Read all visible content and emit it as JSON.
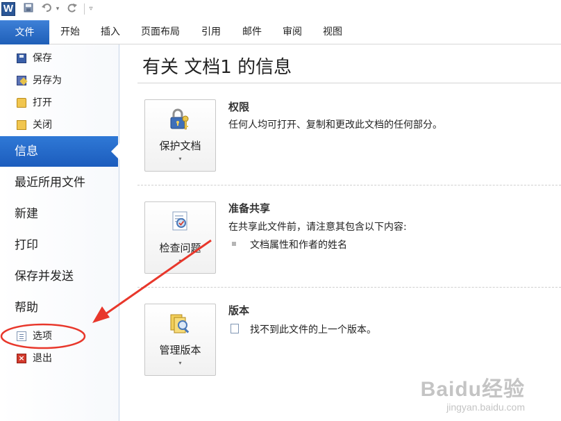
{
  "app": {
    "icon_letter": "W"
  },
  "quick_access": [
    {
      "icon": "save-icon",
      "glyph": "💾"
    },
    {
      "icon": "undo-icon",
      "glyph": "↶"
    },
    {
      "icon": "undo-dropdown-icon",
      "glyph": "▾"
    },
    {
      "icon": "redo-icon",
      "glyph": "↻"
    },
    {
      "icon": "customize-qat-icon",
      "glyph": "▿"
    }
  ],
  "ribbon": {
    "file_tab": "文件",
    "tabs": [
      "开始",
      "插入",
      "页面布局",
      "引用",
      "邮件",
      "审阅",
      "视图"
    ]
  },
  "nav": {
    "commands_top": [
      {
        "icon": "save-icon",
        "label": "保存"
      },
      {
        "icon": "save-as-icon",
        "label": "另存为"
      },
      {
        "icon": "open-folder-icon",
        "label": "打开"
      },
      {
        "icon": "close-folder-icon",
        "label": "关闭"
      }
    ],
    "tabs": [
      "信息",
      "最近所用文件",
      "新建",
      "打印",
      "保存并发送",
      "帮助"
    ],
    "selected_tab": "信息",
    "commands_bottom": [
      {
        "icon": "options-icon",
        "label": "选项"
      },
      {
        "icon": "exit-icon",
        "label": "退出"
      }
    ]
  },
  "main": {
    "title": "有关 文档1 的信息",
    "sections": [
      {
        "button_label": "保护文档",
        "button_icon": "lock-key-icon",
        "title": "权限",
        "desc": "任何人均可打开、复制和更改此文档的任何部分。"
      },
      {
        "button_label": "检查问题",
        "button_icon": "inspect-document-icon",
        "title": "准备共享",
        "desc": "在共享此文件前，请注意其包含以下内容:",
        "bullets": [
          "文档属性和作者的姓名"
        ]
      },
      {
        "button_label": "管理版本",
        "button_icon": "manage-versions-icon",
        "title": "版本",
        "desc": "找不到此文件的上一个版本。"
      }
    ]
  },
  "annotation": {
    "highlight_color": "#e8372b"
  },
  "watermark": {
    "main": "Baidu经验",
    "sub": "jingyan.baidu.com"
  }
}
